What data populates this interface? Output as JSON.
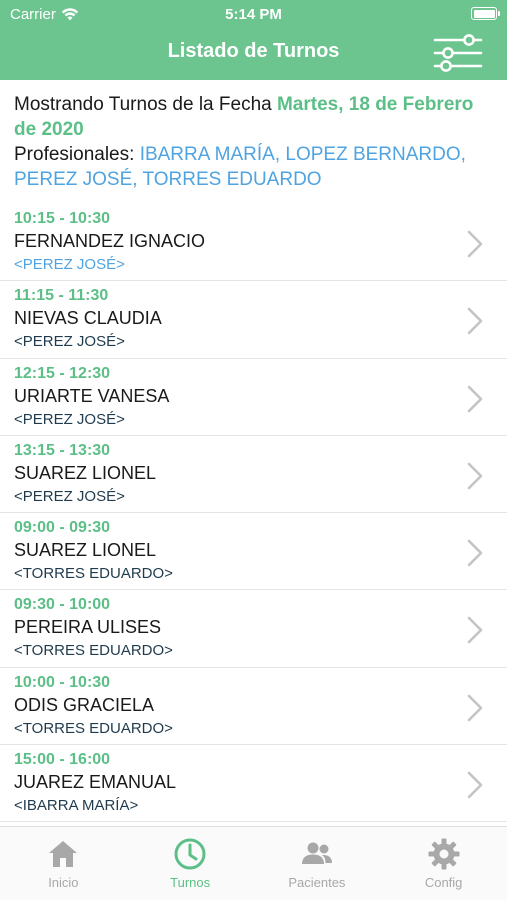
{
  "status_bar": {
    "carrier": "Carrier",
    "time": "5:14 PM"
  },
  "header": {
    "title": "Listado de Turnos"
  },
  "info": {
    "date_prefix": "Mostrando Turnos de la Fecha",
    "date_value": "Martes, 18 de Febrero de 2020",
    "pros_prefix": "Profesionales:",
    "pros_value": "IBARRA MARÍA, LOPEZ BERNARDO, PEREZ JOSÉ, TORRES EDUARDO"
  },
  "appointments": [
    {
      "time": "10:15 - 10:30",
      "patient": "FERNANDEZ IGNACIO",
      "professional": "<PEREZ JOSÉ>",
      "pro_color": "#4fa3e0"
    },
    {
      "time": "11:15 - 11:30",
      "patient": "NIEVAS CLAUDIA",
      "professional": "<PEREZ JOSÉ>",
      "pro_color": "#1f3b4d"
    },
    {
      "time": "12:15 - 12:30",
      "patient": "URIARTE VANESA",
      "professional": "<PEREZ JOSÉ>",
      "pro_color": "#1f3b4d"
    },
    {
      "time": "13:15 - 13:30",
      "patient": "SUAREZ LIONEL",
      "professional": "<PEREZ JOSÉ>",
      "pro_color": "#1f3b4d"
    },
    {
      "time": "09:00 - 09:30",
      "patient": "SUAREZ LIONEL",
      "professional": "<TORRES EDUARDO>",
      "pro_color": "#1f3b4d"
    },
    {
      "time": "09:30 - 10:00",
      "patient": "PEREIRA ULISES",
      "professional": "<TORRES EDUARDO>",
      "pro_color": "#1f3b4d"
    },
    {
      "time": "10:00 - 10:30",
      "patient": "ODIS GRACIELA",
      "professional": "<TORRES EDUARDO>",
      "pro_color": "#1f3b4d"
    },
    {
      "time": "15:00 - 16:00",
      "patient": "JUAREZ EMANUAL",
      "professional": "<IBARRA MARÍA>",
      "pro_color": "#1f3b4d"
    }
  ],
  "tabbar": {
    "items": [
      {
        "label": "Inicio",
        "icon": "home-icon",
        "active": false
      },
      {
        "label": "Turnos",
        "icon": "clock-icon",
        "active": true
      },
      {
        "label": "Pacientes",
        "icon": "users-icon",
        "active": false
      },
      {
        "label": "Config",
        "icon": "gear-icon",
        "active": false
      }
    ]
  },
  "colors": {
    "brand_green": "#6cc48f",
    "accent_green": "#5cbf87",
    "link_blue": "#4fa3e0",
    "inactive_gray": "#a8a8a8"
  }
}
